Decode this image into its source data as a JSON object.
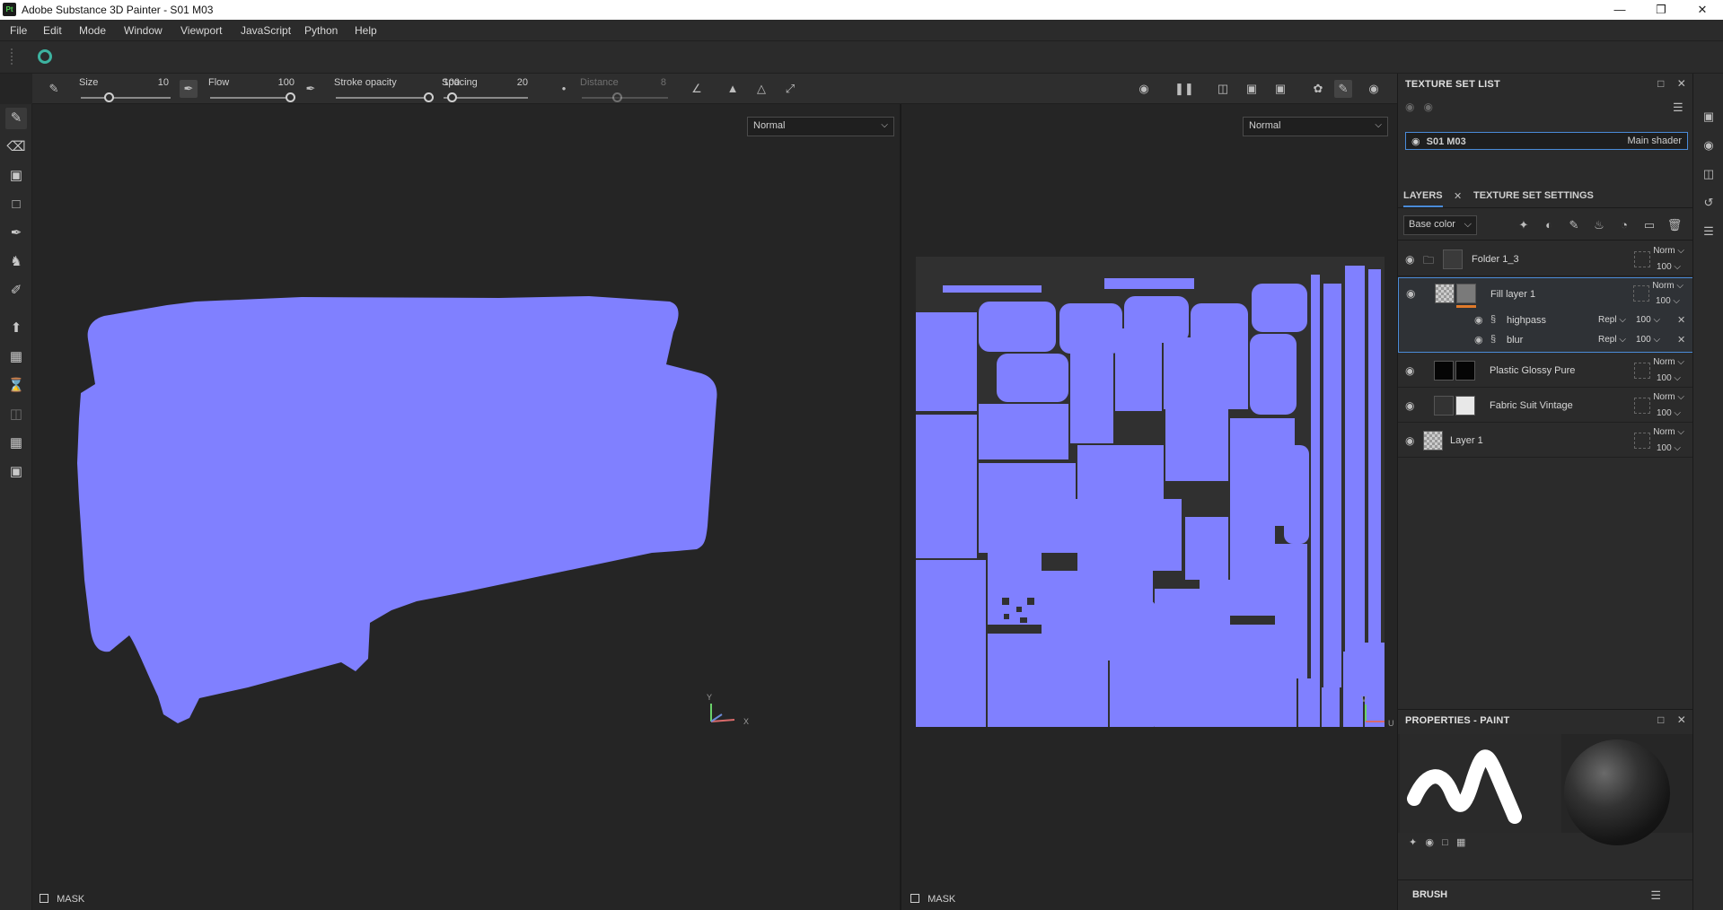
{
  "window": {
    "title": "Adobe Substance 3D Painter - S01 M03",
    "app_icon": "Pt"
  },
  "menu": [
    "File",
    "Edit",
    "Mode",
    "Window",
    "Viewport",
    "JavaScript",
    "Python",
    "Help"
  ],
  "tool_options": {
    "size": {
      "label": "Size",
      "value": "10"
    },
    "flow": {
      "label": "Flow",
      "value": "100"
    },
    "stroke_opacity": {
      "label": "Stroke opacity",
      "value": "100"
    },
    "spacing": {
      "label": "Spacing",
      "value": "20"
    },
    "distance": {
      "label": "Distance",
      "value": "8"
    }
  },
  "viewport_3d": {
    "blend_mode": "Normal",
    "mask_label": "MASK",
    "axis_y": "Y",
    "axis_x": "X",
    "mesh_color": "#8080ff"
  },
  "viewport_2d": {
    "blend_mode": "Normal",
    "mask_label": "MASK",
    "axis_v": "V",
    "axis_u": "U",
    "uv_color": "#8080ff"
  },
  "texture_set_list": {
    "title": "TEXTURE SET LIST",
    "set_name": "S01 M03",
    "shader": "Main shader"
  },
  "layers_panel": {
    "tab_layers": "LAYERS",
    "tab_settings": "TEXTURE SET SETTINGS",
    "channel": "Base color",
    "layers": [
      {
        "name": "Folder 1_3",
        "blend": "Norm",
        "opacity": "100"
      },
      {
        "name": "Fill layer 1",
        "blend": "Norm",
        "opacity": "100",
        "effects": [
          {
            "name": "highpass",
            "blend": "Repl",
            "opacity": "100"
          },
          {
            "name": "blur",
            "blend": "Repl",
            "opacity": "100"
          }
        ]
      },
      {
        "name": "Plastic Glossy Pure",
        "blend": "Norm",
        "opacity": "100"
      },
      {
        "name": "Fabric Suit Vintage",
        "blend": "Norm",
        "opacity": "100"
      },
      {
        "name": "Layer 1",
        "blend": "Norm",
        "opacity": "100"
      }
    ]
  },
  "properties": {
    "title": "PROPERTIES - PAINT",
    "brush_label": "BRUSH"
  },
  "colors": {
    "accent": "#4a8bd8",
    "mesh": "#8080ff"
  }
}
